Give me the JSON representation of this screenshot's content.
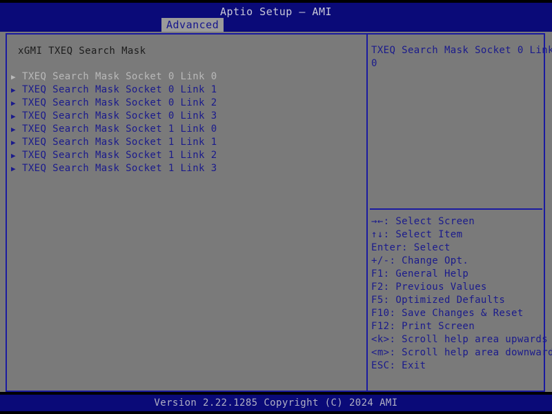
{
  "window": {
    "title": "Aptio Setup – AMI"
  },
  "tabs": [
    {
      "label": "Advanced",
      "active": true
    }
  ],
  "main": {
    "section_title": "xGMI TXEQ Search Mask",
    "items": [
      {
        "label": "TXEQ Search Mask Socket 0 Link 0",
        "arrow": "submenu-arrow",
        "selected": true
      },
      {
        "label": "TXEQ Search Mask Socket 0 Link 1",
        "arrow": "submenu-arrow",
        "selected": false
      },
      {
        "label": "TXEQ Search Mask Socket 0 Link 2",
        "arrow": "submenu-arrow",
        "selected": false
      },
      {
        "label": "TXEQ Search Mask Socket 0 Link 3",
        "arrow": "submenu-arrow",
        "selected": false
      },
      {
        "label": "TXEQ Search Mask Socket 1 Link 0",
        "arrow": "submenu-arrow",
        "selected": false
      },
      {
        "label": "TXEQ Search Mask Socket 1 Link 1",
        "arrow": "submenu-arrow",
        "selected": false
      },
      {
        "label": "TXEQ Search Mask Socket 1 Link 2",
        "arrow": "submenu-arrow",
        "selected": false
      },
      {
        "label": "TXEQ Search Mask Socket 1 Link 3",
        "arrow": "submenu-arrow",
        "selected": false
      }
    ]
  },
  "help": {
    "lines": [
      "TXEQ Search Mask Socket 0 Link",
      "0"
    ]
  },
  "legend": [
    "→←: Select Screen",
    "↑↓: Select Item",
    "Enter: Select",
    "+/-: Change Opt.",
    "F1: General Help",
    "F2: Previous Values",
    "F5: Optimized Defaults",
    "F10: Save Changes & Reset",
    "F12: Print Screen",
    "<k>: Scroll help area upwards",
    "<m>: Scroll help area downwards",
    "ESC: Exit"
  ],
  "footer": {
    "version_text": "Version 2.22.1285 Copyright (C) 2024 AMI"
  },
  "colors": {
    "background_gray": "#7a7a7a",
    "header_blue": "#0a0a78",
    "text_blue": "#1a1a8c",
    "selected_text": "#b9b9b9",
    "border_blue": "#1a1aa0",
    "title_text": "#c8c8d8"
  },
  "icons": {
    "submenu_arrow_glyph": "▶"
  }
}
